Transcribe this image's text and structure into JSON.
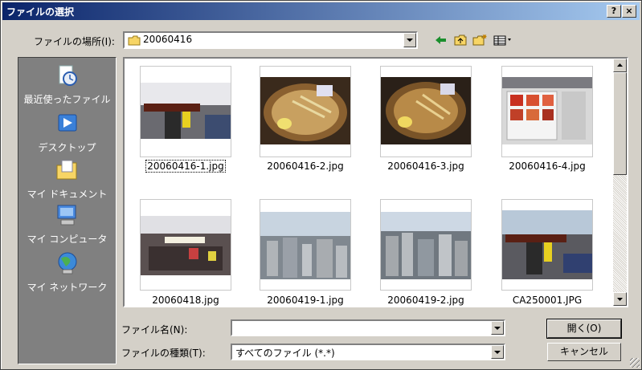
{
  "window": {
    "title": "ファイルの選択",
    "help": "?",
    "close": "×"
  },
  "location": {
    "label": "ファイルの場所(I):",
    "value": "20060416"
  },
  "places": [
    {
      "label": "最近使ったファイル",
      "icon": "recent-documents-icon"
    },
    {
      "label": "デスクトップ",
      "icon": "desktop-icon"
    },
    {
      "label": "マイ ドキュメント",
      "icon": "my-documents-icon"
    },
    {
      "label": "マイ コンピュータ",
      "icon": "my-computer-icon"
    },
    {
      "label": "マイ ネットワーク",
      "icon": "my-network-icon"
    }
  ],
  "files": [
    {
      "name": "20060416-1.jpg",
      "selected": true
    },
    {
      "name": "20060416-2.jpg"
    },
    {
      "name": "20060416-3.jpg"
    },
    {
      "name": "20060416-4.jpg"
    },
    {
      "name": "20060418.jpg"
    },
    {
      "name": "20060419-1.jpg"
    },
    {
      "name": "20060419-2.jpg"
    },
    {
      "name": "CA250001.JPG"
    }
  ],
  "filename": {
    "label": "ファイル名(N):",
    "value": ""
  },
  "filetype": {
    "label": "ファイルの種類(T):",
    "value": "すべてのファイル (*.*)"
  },
  "buttons": {
    "open": "開く(O)",
    "cancel": "キャンセル"
  },
  "colors": {
    "titlebar_start": "#0a246a",
    "titlebar_end": "#a6caf0",
    "face": "#d4d0c8",
    "places_bg": "#808080"
  }
}
